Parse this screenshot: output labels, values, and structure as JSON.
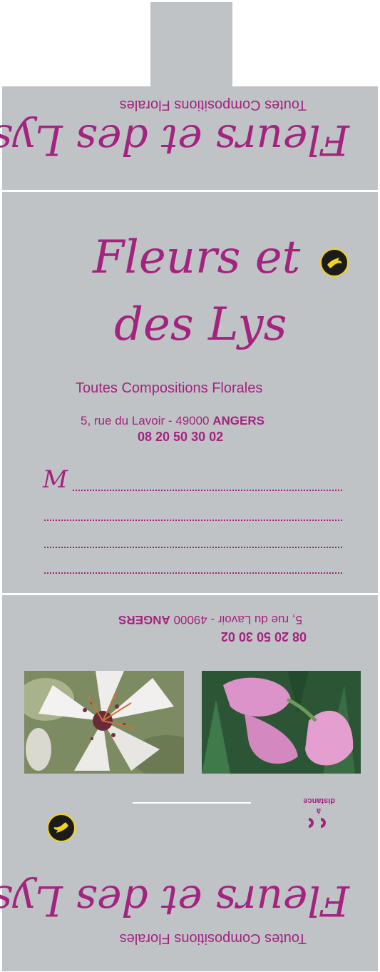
{
  "shop": {
    "name_line1": "Fleurs et",
    "name_line2": "des Lys",
    "name_full": "Fleurs et des Lys",
    "tagline": "Toutes Compositions Florales",
    "address": "5, rue du Lavoir - 49000",
    "city": "ANGERS",
    "phone": "08 20 50 30 02"
  },
  "form": {
    "salutation": "M"
  },
  "footer": {
    "distance_label_a": "à",
    "distance_label_b": "distance"
  },
  "images": {
    "left": "lily-photo",
    "right": "calla-photo"
  },
  "badge_text": "INTERFLORA",
  "colors": {
    "background": "#c0c3c6",
    "accent": "#a3237f",
    "badge_ring": "#f2d21c"
  }
}
